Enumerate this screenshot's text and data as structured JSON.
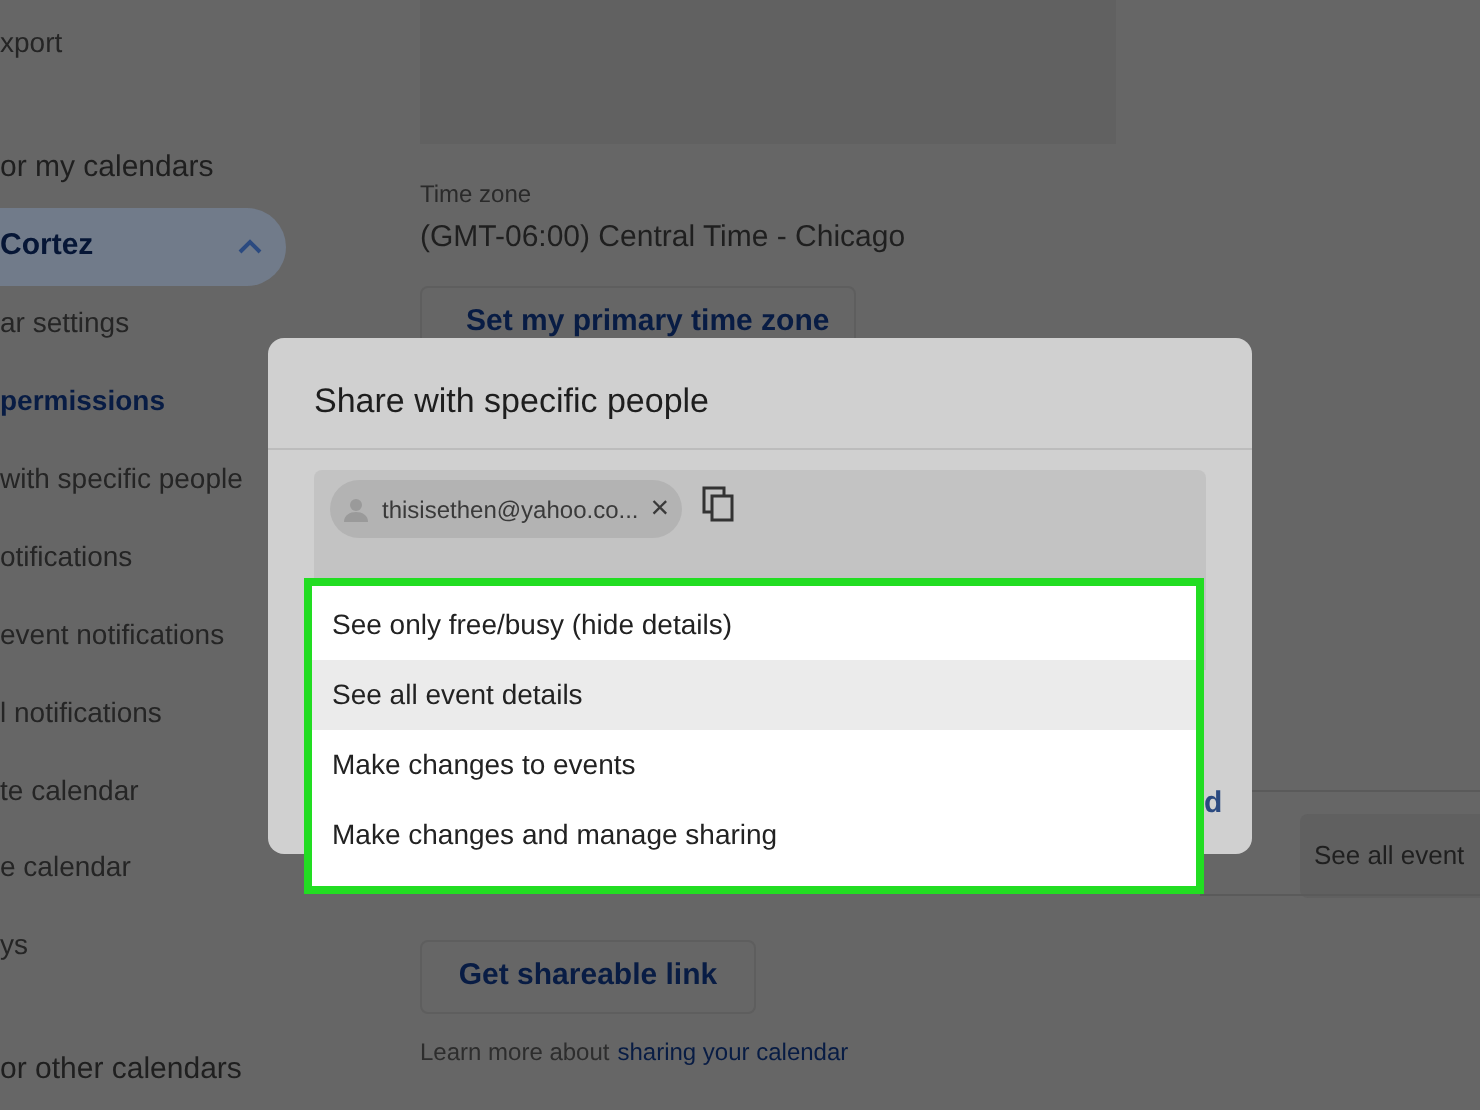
{
  "sidebar": {
    "items": [
      {
        "kind": "item",
        "label": "xport",
        "selected": false
      },
      {
        "kind": "heading",
        "label": "or my calendars"
      },
      {
        "kind": "calendar",
        "label": "Cortez",
        "selected": true,
        "expanded": true
      },
      {
        "kind": "item",
        "label": "ar settings",
        "selected": false
      },
      {
        "kind": "item",
        "label": "permissions",
        "selected": true
      },
      {
        "kind": "item",
        "label": "with specific people",
        "selected": false
      },
      {
        "kind": "item",
        "label": "otifications",
        "selected": false
      },
      {
        "kind": "item",
        "label": "event notifications",
        "selected": false
      },
      {
        "kind": "item",
        "label": "l notifications",
        "selected": false
      },
      {
        "kind": "item",
        "label": "te calendar",
        "selected": false
      },
      {
        "kind": "item",
        "label": "e calendar",
        "selected": false
      },
      {
        "kind": "item",
        "label": "ys",
        "selected": false
      },
      {
        "kind": "heading",
        "label": "or other calendars"
      }
    ]
  },
  "settings": {
    "time_zone_label": "Time zone",
    "time_zone_value": "(GMT-06:00) Central Time - Chicago",
    "primary_tz_button": "Set my primary time zone",
    "permission_select": "See all event",
    "shareable_link_button": "Get shareable link",
    "learn_more_text": "Learn more about",
    "learn_more_link": "sharing your calendar"
  },
  "dialog": {
    "title": "Share with specific people",
    "chip": "thisisethen@yahoo.co...",
    "chip_close": "×",
    "cut_link": "d"
  },
  "menu": {
    "items": [
      {
        "label": "See only free/busy (hide details)",
        "selected": false
      },
      {
        "label": "See all event details",
        "selected": true
      },
      {
        "label": "Make changes to events",
        "selected": false
      },
      {
        "label": "Make changes and manage sharing",
        "selected": false
      }
    ]
  }
}
